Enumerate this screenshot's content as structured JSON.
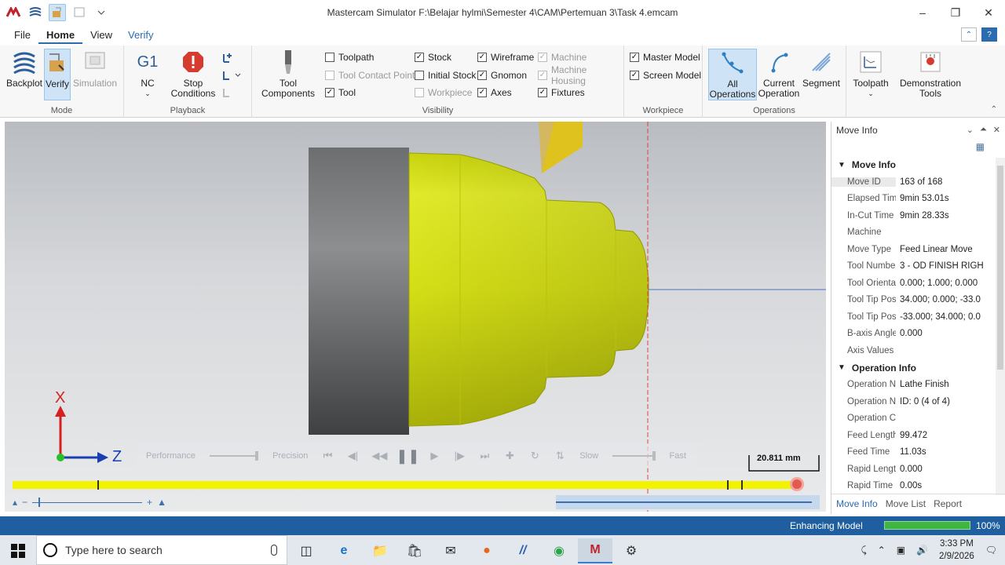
{
  "window": {
    "title": "Mastercam Simulator  F:\\Belajar hylmi\\Semester 4\\CAM\\Pertemuan 3\\Task 4.emcam"
  },
  "menu": {
    "tabs": [
      "File",
      "Home",
      "View",
      "Verify"
    ],
    "active": "Home"
  },
  "ribbon": {
    "mode": {
      "label": "Mode",
      "backplot": "Backplot",
      "verify": "Verify",
      "simulation": "Simulation"
    },
    "playback": {
      "label": "Playback",
      "nc_icon": "G1",
      "nc": "NC",
      "stop1": "Stop",
      "stop2": "Conditions"
    },
    "visibility": {
      "label": "Visibility",
      "tool_comp1": "Tool",
      "tool_comp2": "Components",
      "toolpath": "Toolpath",
      "tool_contact_point": "Tool Contact Point",
      "tool": "Tool",
      "stock": "Stock",
      "initial_stock": "Initial Stock",
      "workpiece": "Workpiece",
      "wireframe": "Wireframe",
      "gnomon": "Gnomon",
      "axes": "Axes",
      "machine": "Machine",
      "machine_housing": "Machine Housing",
      "fixtures": "Fixtures"
    },
    "workpiece": {
      "label": "Workpiece",
      "master_model": "Master Model",
      "screen_model": "Screen Model"
    },
    "operations": {
      "label": "Operations",
      "all1": "All",
      "all2": "Operations",
      "current1": "Current",
      "current2": "Operation",
      "segment": "Segment"
    },
    "toolpath": "Toolpath",
    "demo1": "Demonstration",
    "demo2": "Tools"
  },
  "viewport": {
    "scale": "20.811 mm",
    "axis_x": "X",
    "axis_z": "Z",
    "controls": {
      "performance": "Performance",
      "precision": "Precision",
      "slow": "Slow",
      "fast": "Fast"
    }
  },
  "move_info": {
    "panel_title": "Move Info",
    "section": "Move Info",
    "rows": [
      {
        "k": "Move ID",
        "v": "163 of 168"
      },
      {
        "k": "Elapsed Time",
        "v": "9min 53.01s"
      },
      {
        "k": "In-Cut Time",
        "v": "9min 28.33s"
      },
      {
        "k": "Machine",
        "v": ""
      },
      {
        "k": "Move Type",
        "v": "Feed Linear Move"
      },
      {
        "k": "Tool Number",
        "v": "3 - OD FINISH RIGH"
      },
      {
        "k": "Tool Orientati...",
        "v": "0.000; 1.000; 0.000"
      },
      {
        "k": "Tool Tip Positi...",
        "v": "34.000; 0.000; -33.0"
      },
      {
        "k": "Tool Tip Positi...",
        "v": "-33.000; 34.000; 0.0"
      },
      {
        "k": "B-axis Angle",
        "v": "0.000"
      },
      {
        "k": "Axis Values",
        "v": ""
      }
    ],
    "op_section": "Operation Info",
    "op_rows": [
      {
        "k": "Operation Na...",
        "v": "Lathe Finish"
      },
      {
        "k": "Operation Nu...",
        "v": "ID: 0 (4 of 4)"
      },
      {
        "k": "Operation Co...",
        "v": ""
      },
      {
        "k": "Feed Length",
        "v": "99.472"
      },
      {
        "k": "Feed Time",
        "v": "11.03s"
      },
      {
        "k": "Rapid Length",
        "v": "0.000"
      },
      {
        "k": "Rapid Time",
        "v": "0.00s"
      }
    ],
    "tabs": [
      "Move Info",
      "Move List",
      "Report"
    ]
  },
  "status": {
    "text": "Enhancing Model",
    "percent": "100%",
    "progress": 1.0
  },
  "taskbar": {
    "search_placeholder": "Type here to search",
    "time": "3:33 PM",
    "date": "2/9/2026"
  },
  "colors": {
    "accent": "#2b6cb0",
    "stock_yellow": "#d7e51a",
    "status_blue": "#1f5fa0",
    "timeline_yellow": "#f3f300"
  }
}
